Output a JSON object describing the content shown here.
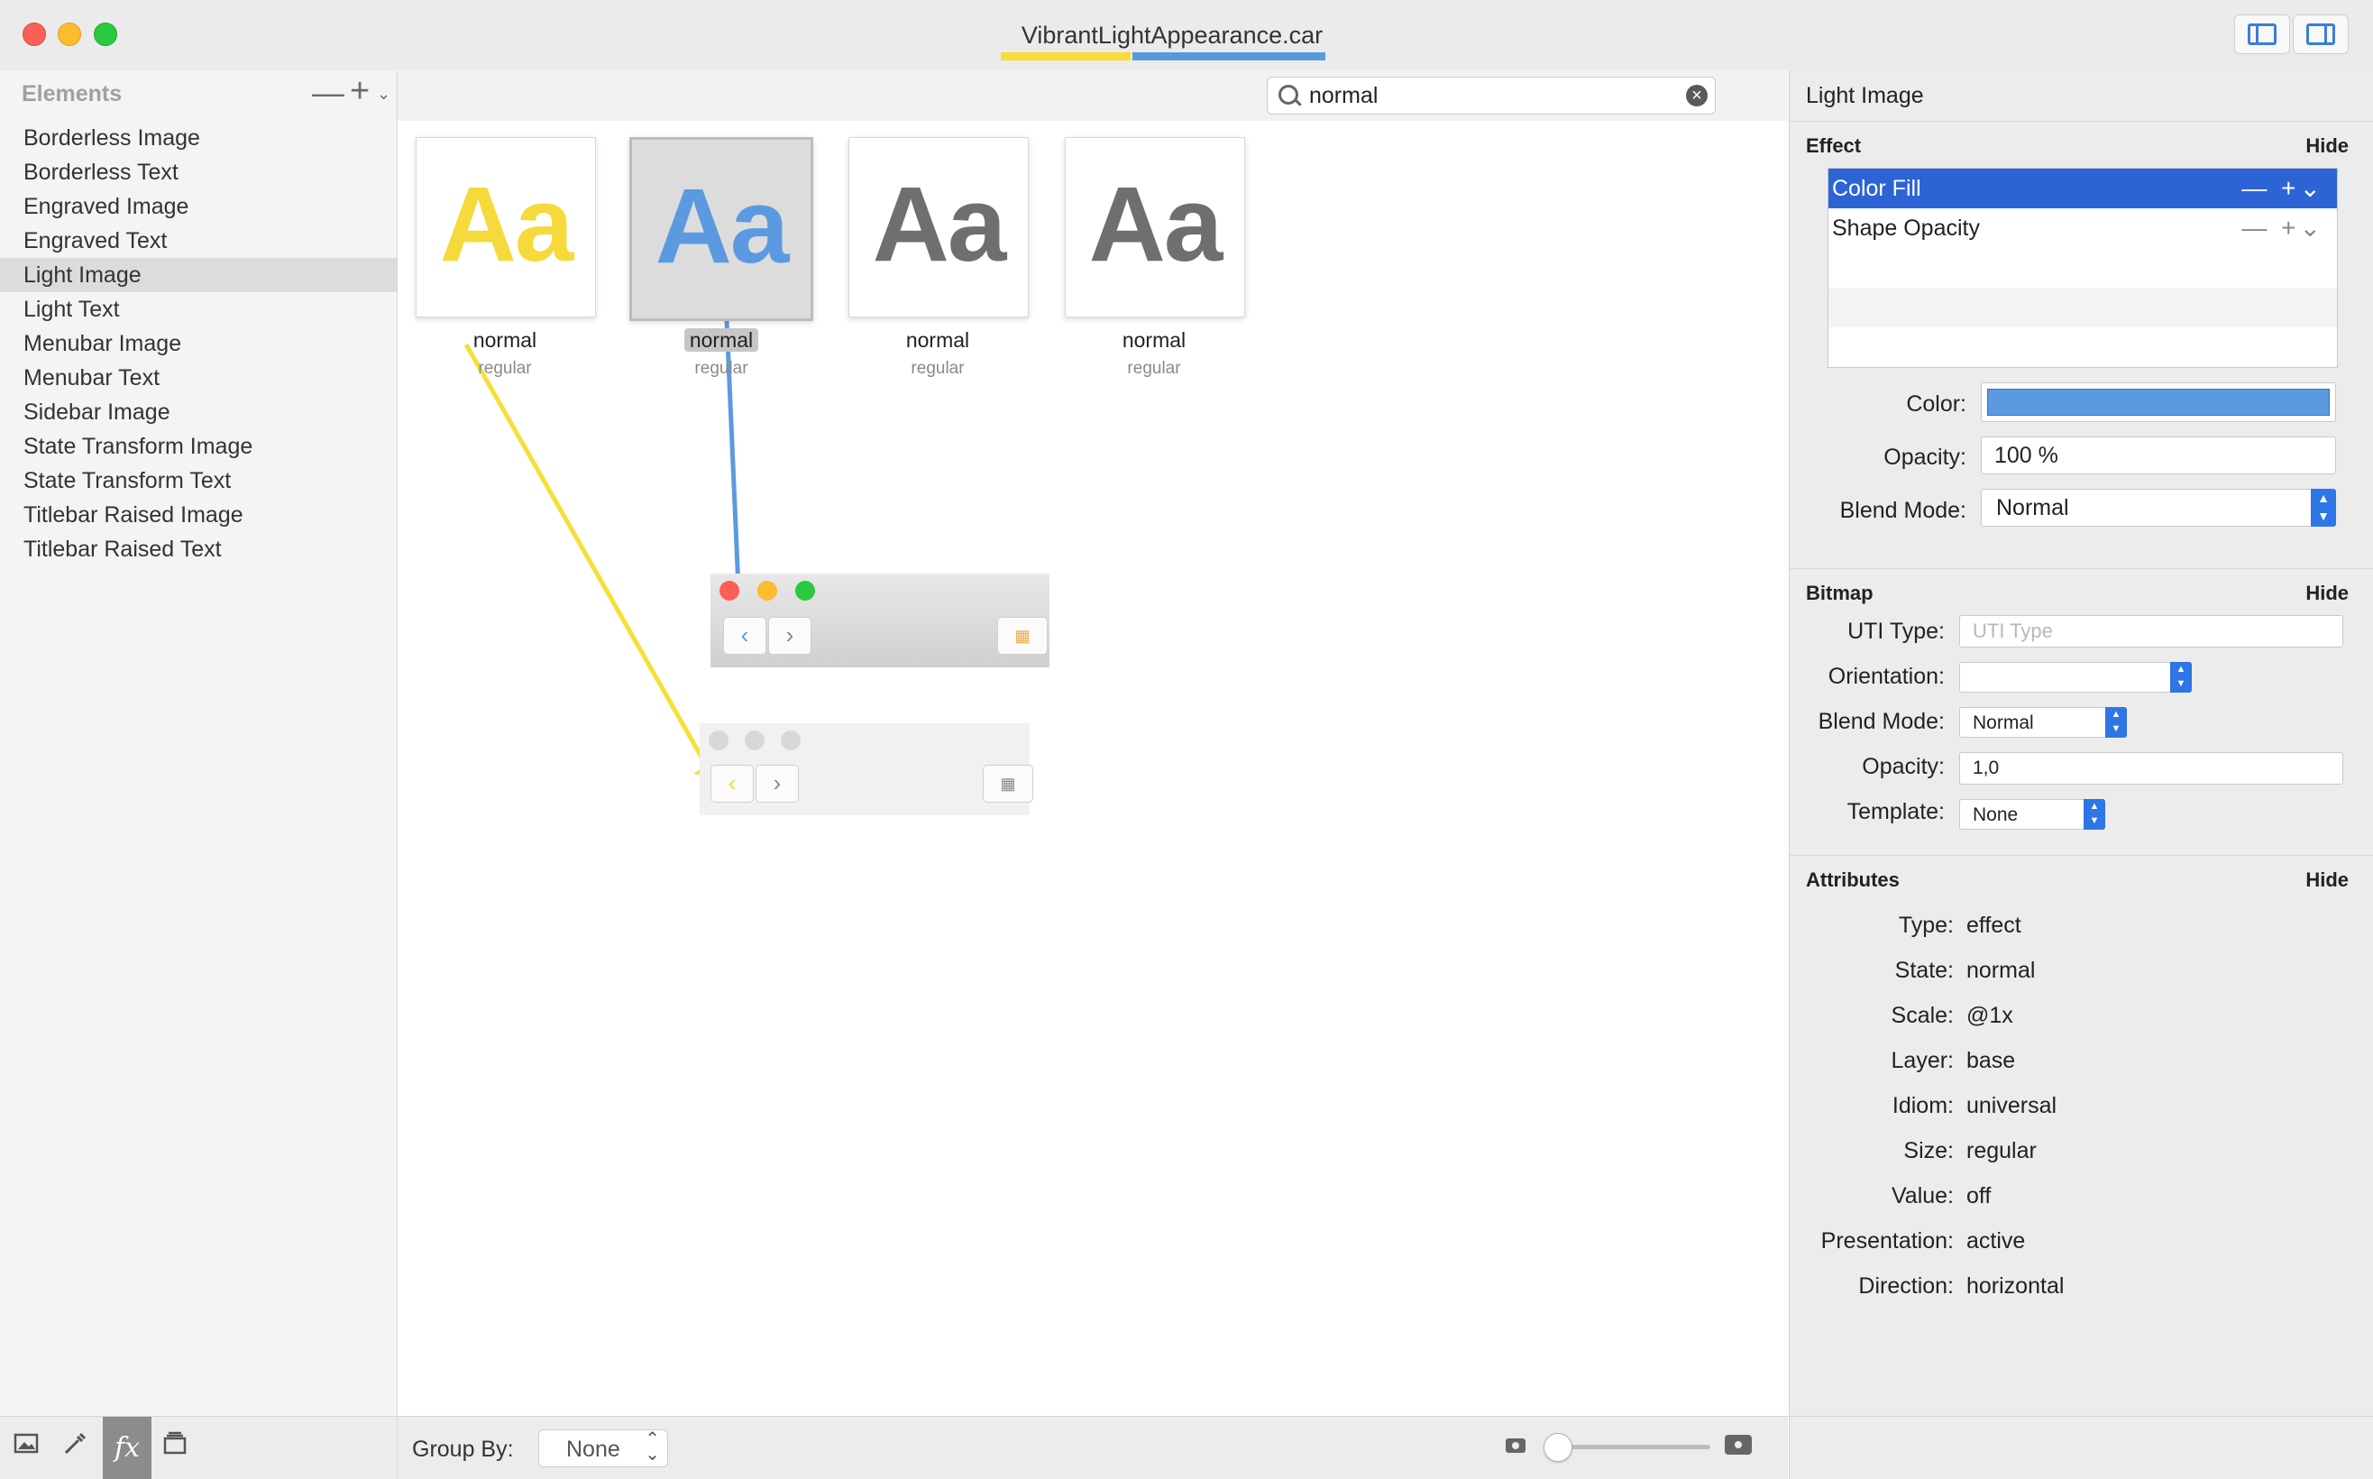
{
  "window": {
    "title": "VibrantLightAppearance.car"
  },
  "sidebar": {
    "header": "Elements",
    "minus": "—",
    "plus": "+",
    "chevron": "⌄",
    "items": [
      {
        "label": "Borderless Image"
      },
      {
        "label": "Borderless Text"
      },
      {
        "label": "Engraved Image"
      },
      {
        "label": "Engraved Text"
      },
      {
        "label": "Light Image"
      },
      {
        "label": "Light Text"
      },
      {
        "label": "Menubar Image"
      },
      {
        "label": "Menubar Text"
      },
      {
        "label": "Sidebar Image"
      },
      {
        "label": "State Transform Image"
      },
      {
        "label": "State Transform Text"
      },
      {
        "label": "Titlebar Raised Image"
      },
      {
        "label": "Titlebar Raised Text"
      }
    ],
    "selected_index": 4
  },
  "search": {
    "value": "normal",
    "placeholder": ""
  },
  "tiles": [
    {
      "glyph": "Aa",
      "label": "normal",
      "sub": "regular",
      "color": "#f6d93a"
    },
    {
      "glyph": "Aa",
      "label": "normal",
      "sub": "regular",
      "color": "#5b9ae0"
    },
    {
      "glyph": "Aa",
      "label": "normal",
      "sub": "regular",
      "color": "#6f6f6f"
    },
    {
      "glyph": "Aa",
      "label": "normal",
      "sub": "regular",
      "color": "#6f6f6f"
    }
  ],
  "preview": {
    "back_glyph": "‹",
    "forward_glyph": "›",
    "grid_glyph": "▦"
  },
  "bottom_bar": {
    "group_by_label": "Group By:",
    "group_by_value": "None",
    "select_arrows": "⌃⌄",
    "zoom": 0.0
  },
  "inspector": {
    "title": "Light Image",
    "effect": {
      "title": "Effect",
      "hide": "Hide",
      "items": [
        {
          "label": "Color Fill",
          "controls": "— +⌄"
        },
        {
          "label": "Shape Opacity",
          "controls": "— +⌄"
        }
      ],
      "color_label": "Color:",
      "color_value": "#5b9ae0",
      "opacity_label": "Opacity:",
      "opacity_value": "100 %",
      "blend_label": "Blend Mode:",
      "blend_value": "Normal"
    },
    "bitmap": {
      "title": "Bitmap",
      "hide": "Hide",
      "uti_label": "UTI Type:",
      "uti_placeholder": "UTI Type",
      "orientation_label": "Orientation:",
      "orientation_value": "",
      "blend_label": "Blend Mode:",
      "blend_value": "Normal",
      "opacity_label": "Opacity:",
      "opacity_value": "1,0",
      "template_label": "Template:",
      "template_value": "None"
    },
    "attributes": {
      "title": "Attributes",
      "hide": "Hide",
      "rows": [
        {
          "label": "Type:",
          "value": "effect"
        },
        {
          "label": "State:",
          "value": "normal"
        },
        {
          "label": "Scale:",
          "value": "@1x"
        },
        {
          "label": "Layer:",
          "value": "base"
        },
        {
          "label": "Idiom:",
          "value": "universal"
        },
        {
          "label": "Size:",
          "value": "regular"
        },
        {
          "label": "Value:",
          "value": "off"
        },
        {
          "label": "Presentation:",
          "value": "active"
        },
        {
          "label": "Direction:",
          "value": "horizontal"
        }
      ]
    }
  },
  "colors": {
    "accent": "#2c64d6",
    "yellow": "#f6d93a",
    "blue": "#5b9ae0"
  }
}
